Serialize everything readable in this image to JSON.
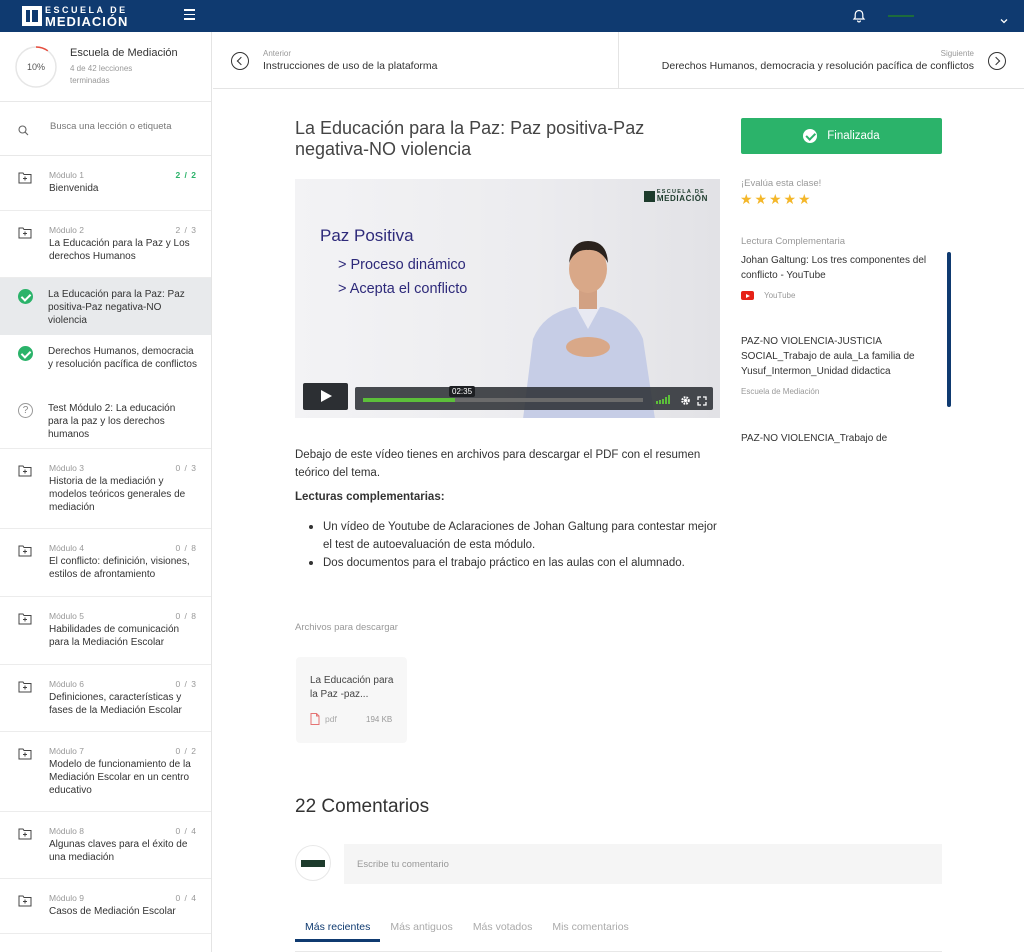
{
  "brand": {
    "line1": "ESCUELA DE",
    "line2": "MEDIACIÓN"
  },
  "course": {
    "progress": "10%",
    "progress_fraction": 0.1,
    "name": "Escuela de Mediación",
    "sub": "4 de 42 lecciones terminadas"
  },
  "search": {
    "placeholder": "Busca una lección o etiqueta"
  },
  "modules": [
    {
      "num": "Módulo 1",
      "count": "2 / 2",
      "title": "Bienvenida"
    },
    {
      "num": "Módulo 2",
      "count": "2 / 3",
      "title": "La Educación para la Paz y Los derechos Humanos"
    },
    {
      "num": "Módulo 3",
      "count": "0 / 3",
      "title": "Historia de la mediación y modelos teóricos generales de mediación"
    },
    {
      "num": "Módulo 4",
      "count": "0 / 8",
      "title": "El conflicto: definición, visiones, estilos de afrontamiento"
    },
    {
      "num": "Módulo 5",
      "count": "0 / 8",
      "title": "Habilidades de comunicación para la Mediación Escolar"
    },
    {
      "num": "Módulo 6",
      "count": "0 / 3",
      "title": "Definiciones, características y fases de la Mediación Escolar"
    },
    {
      "num": "Módulo 7",
      "count": "0 / 2",
      "title": "Modelo de funcionamiento de la Mediación Escolar en un centro educativo"
    },
    {
      "num": "Módulo 8",
      "count": "0 / 4",
      "title": "Algunas claves para el éxito de una mediación"
    },
    {
      "num": "Módulo 9",
      "count": "0 / 4",
      "title": "Casos de Mediación Escolar"
    }
  ],
  "sublessons": [
    {
      "title": "La Educación para la Paz: Paz positiva-Paz negativa-NO violencia"
    },
    {
      "title": "Derechos Humanos, democracia y resolución pacífica de conflictos"
    },
    {
      "title": "Test Módulo 2: La educación para la paz y los derechos humanos"
    }
  ],
  "nav": {
    "prev_label": "Anterior",
    "prev_title": "Instrucciones de uso de la plataforma",
    "next_label": "Siguiente",
    "next_title": "Derechos Humanos, democracia y resolución pacífica de conflictos"
  },
  "lesson": {
    "title": "La Educación para la Paz: Paz positiva-Paz negativa-NO violencia",
    "description": "Debajo de este vídeo tienes en archivos para descargar el PDF con el resumen teórico del tema.",
    "readings_heading": "Lecturas complementarias:",
    "readings": [
      "Un vídeo de Youtube de Aclaraciones de Johan Galtung para contestar mejor el test de autoevaluación de esta módulo.",
      "Dos documentos para el trabajo práctico en las aulas con el alumnado."
    ]
  },
  "video": {
    "logo1": "ESCUELA DE",
    "logo2": "MEDIACIÓN",
    "heading": "Paz Positiva",
    "line1": "> Proceso dinámico",
    "line2": "> Acepta el conflicto",
    "time": "02:35",
    "progress_fraction": 0.33
  },
  "downloads": {
    "label": "Archivos para descargar",
    "file_name": "La Educación para la Paz -paz...",
    "ext": "pdf",
    "size": "194 KB"
  },
  "comments": {
    "heading": "22 Comentarios",
    "placeholder": "Escribe tu comentario",
    "tabs": [
      "Más recientes",
      "Más antiguos",
      "Más votados",
      "Mis comentarios"
    ]
  },
  "sidebar_right": {
    "finish_label": "Finalizada",
    "rate_label": "¡Evalúa esta clase!",
    "rating": 5,
    "readings_label": "Lectura Complementaria",
    "resources": [
      {
        "title": "Johan Galtung: Los tres componentes del conflicto - YouTube",
        "source": "YouTube"
      },
      {
        "title": "PAZ-NO VIOLENCIA-JUSTICIA SOCIAL_Trabajo de aula_La familia de Yusuf_Intermon_Unidad didactica",
        "source": "Escuela de Mediación"
      },
      {
        "title": "PAZ-NO VIOLENCIA_Trabajo de",
        "source": ""
      }
    ]
  },
  "colors": {
    "brand": "#0f3a70",
    "success": "#2bb36a",
    "star": "#f4b72a"
  }
}
